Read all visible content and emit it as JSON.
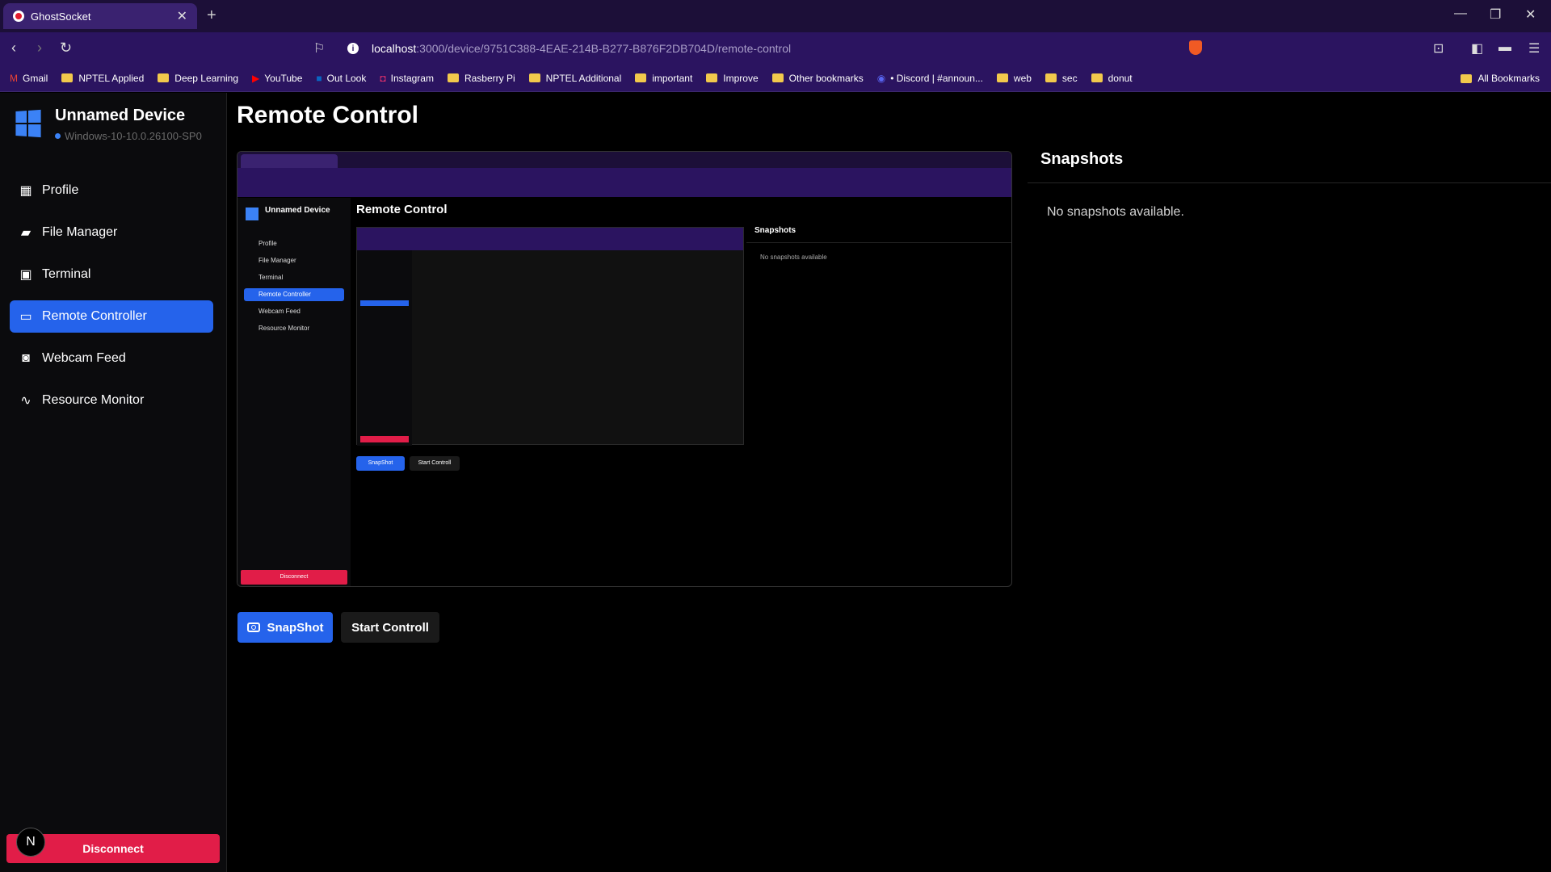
{
  "browser": {
    "tab_title": "GhostSocket",
    "url_host": "localhost",
    "url_path": ":3000/device/9751C388-4EAE-214B-B277-B876F2DB704D/remote-control",
    "bookmarks": [
      {
        "label": "Gmail",
        "icon": "gmail-icon"
      },
      {
        "label": "NPTEL Applied",
        "icon": "folder-icon"
      },
      {
        "label": "Deep Learning",
        "icon": "folder-icon"
      },
      {
        "label": "YouTube",
        "icon": "youtube-icon"
      },
      {
        "label": "Out Look",
        "icon": "outlook-icon"
      },
      {
        "label": "Instagram",
        "icon": "instagram-icon"
      },
      {
        "label": "Rasberry Pi",
        "icon": "folder-icon"
      },
      {
        "label": "NPTEL Additional",
        "icon": "folder-icon"
      },
      {
        "label": "important",
        "icon": "folder-icon"
      },
      {
        "label": "Improve",
        "icon": "folder-icon"
      },
      {
        "label": "Other bookmarks",
        "icon": "folder-icon"
      },
      {
        "label": "• Discord | #announ...",
        "icon": "discord-icon"
      },
      {
        "label": "web",
        "icon": "folder-icon"
      },
      {
        "label": "sec",
        "icon": "folder-icon"
      },
      {
        "label": "donut",
        "icon": "folder-icon"
      }
    ],
    "all_bookmarks": "All Bookmarks"
  },
  "device": {
    "name": "Unnamed Device",
    "os": "Windows-10-10.0.26100-SP0",
    "status_color": "#3b82f6"
  },
  "sidebar": {
    "items": [
      {
        "label": "Profile",
        "icon": "profile-icon"
      },
      {
        "label": "File Manager",
        "icon": "folder-icon"
      },
      {
        "label": "Terminal",
        "icon": "terminal-icon"
      },
      {
        "label": "Remote Controller",
        "icon": "monitor-icon",
        "active": true
      },
      {
        "label": "Webcam Feed",
        "icon": "camera-icon"
      },
      {
        "label": "Resource Monitor",
        "icon": "chart-line-icon"
      }
    ],
    "disconnect_label": "Disconnect",
    "avatar_letter": "N"
  },
  "main": {
    "title": "Remote Control",
    "snapshot_button": "SnapShot",
    "start_button": "Start Controll"
  },
  "snapshots": {
    "title": "Snapshots",
    "empty_text": "No snapshots available."
  },
  "preview": {
    "device_name": "Unnamed Device",
    "title": "Remote Control",
    "snapshots_title": "Snapshots",
    "empty_text": "No snapshots available",
    "disconnect": "Disconnect",
    "snapshot_button": "SnapShot",
    "start_button": "Start Controll"
  },
  "colors": {
    "accent": "#2563eb",
    "danger": "#e11d48",
    "chrome": "#2b1460"
  }
}
